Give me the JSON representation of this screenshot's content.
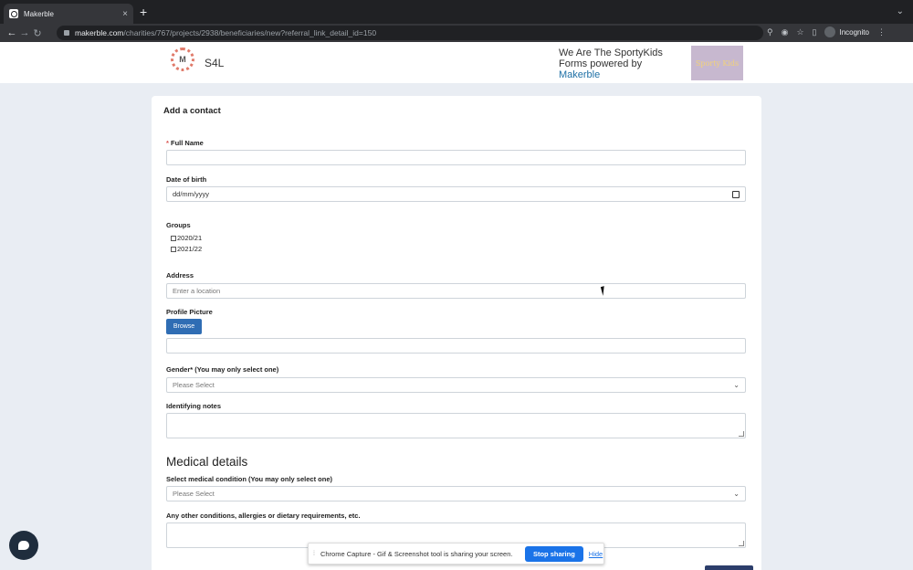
{
  "browser": {
    "tab_title": "Makerble",
    "tab_close": "×",
    "new_tab": "+",
    "url_host": "makerble.com",
    "url_path": "/charities/767/projects/2938/beneficiaries/new?referral_link_detail_id=150",
    "profile_label": "Incognito"
  },
  "site": {
    "logo_letter": "M",
    "brand": "S4L",
    "powered_line1": "We Are The SportyKids",
    "powered_line2": "Forms powered by",
    "powered_brand": "Makerble",
    "partner_logo_text": "Sporty Kids"
  },
  "form": {
    "title": "Add a contact",
    "full_name_required_mark": "*",
    "full_name_label": "Full Name",
    "dob_label": "Date of birth",
    "dob_value": "dd/mm/yyyy",
    "groups_label": "Groups",
    "groups": [
      "2020/21",
      "2021/22"
    ],
    "address_label": "Address",
    "address_placeholder": "Enter a location",
    "profile_picture_label": "Profile Picture",
    "browse_label": "Browse",
    "gender_label": "Gender* (You may only select one)",
    "gender_value": "Please Select",
    "identifying_notes_label": "Identifying notes",
    "medical_section": "Medical details",
    "medical_condition_label": "Select medical condition (You may only select one)",
    "medical_condition_value": "Please Select",
    "other_conditions_label": "Any other conditions, allergies or dietary requirements, etc."
  },
  "share_bar": {
    "message": "Chrome Capture - Gif & Screenshot tool is sharing your screen.",
    "stop_label": "Stop sharing",
    "hide_label": "Hide"
  }
}
